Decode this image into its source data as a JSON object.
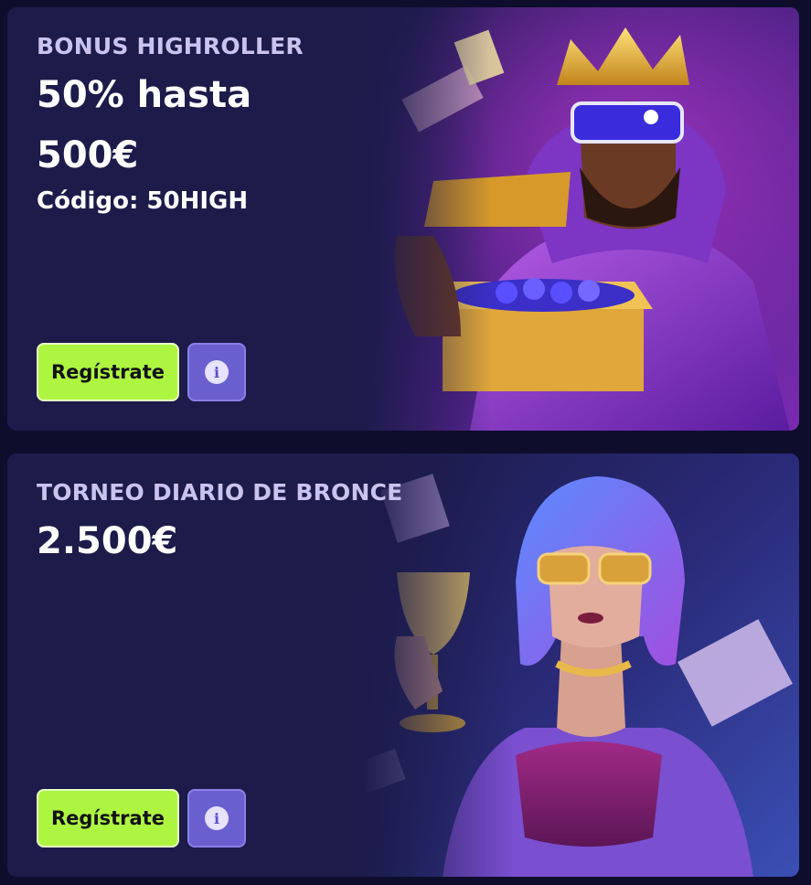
{
  "promos": [
    {
      "eyebrow": "BONUS HIGHROLLER",
      "headline_line1": "50% hasta",
      "headline_line2": "500€",
      "code_line": "Código: 50HIGH",
      "register_label": "Regístrate",
      "info_icon": "i",
      "art_icon": "king-with-treasure-chest-illustration"
    },
    {
      "eyebrow": "TORNEO DIARIO DE BRONCE",
      "headline_line1": "2.500€",
      "register_label": "Regístrate",
      "info_icon": "i",
      "art_icon": "woman-with-golden-goblet-illustration"
    }
  ],
  "colors": {
    "page_background": "#0e0d2c",
    "card_background": "#1c1b4a",
    "register_button": "#aef542",
    "info_button": "#6a5fce",
    "eyebrow_text": "#c9c3ee"
  }
}
